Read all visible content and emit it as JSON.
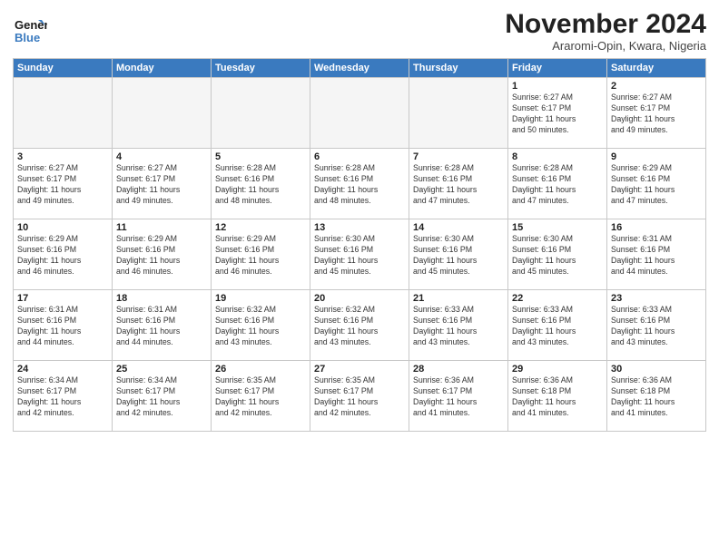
{
  "header": {
    "logo_line1": "General",
    "logo_line2": "Blue",
    "title": "November 2024",
    "subtitle": "Araromi-Opin, Kwara, Nigeria"
  },
  "days_of_week": [
    "Sunday",
    "Monday",
    "Tuesday",
    "Wednesday",
    "Thursday",
    "Friday",
    "Saturday"
  ],
  "weeks": [
    [
      {
        "day": "",
        "info": "",
        "empty": true
      },
      {
        "day": "",
        "info": "",
        "empty": true
      },
      {
        "day": "",
        "info": "",
        "empty": true
      },
      {
        "day": "",
        "info": "",
        "empty": true
      },
      {
        "day": "",
        "info": "",
        "empty": true
      },
      {
        "day": "1",
        "info": "Sunrise: 6:27 AM\nSunset: 6:17 PM\nDaylight: 11 hours\nand 50 minutes."
      },
      {
        "day": "2",
        "info": "Sunrise: 6:27 AM\nSunset: 6:17 PM\nDaylight: 11 hours\nand 49 minutes."
      }
    ],
    [
      {
        "day": "3",
        "info": "Sunrise: 6:27 AM\nSunset: 6:17 PM\nDaylight: 11 hours\nand 49 minutes."
      },
      {
        "day": "4",
        "info": "Sunrise: 6:27 AM\nSunset: 6:17 PM\nDaylight: 11 hours\nand 49 minutes."
      },
      {
        "day": "5",
        "info": "Sunrise: 6:28 AM\nSunset: 6:16 PM\nDaylight: 11 hours\nand 48 minutes."
      },
      {
        "day": "6",
        "info": "Sunrise: 6:28 AM\nSunset: 6:16 PM\nDaylight: 11 hours\nand 48 minutes."
      },
      {
        "day": "7",
        "info": "Sunrise: 6:28 AM\nSunset: 6:16 PM\nDaylight: 11 hours\nand 47 minutes."
      },
      {
        "day": "8",
        "info": "Sunrise: 6:28 AM\nSunset: 6:16 PM\nDaylight: 11 hours\nand 47 minutes."
      },
      {
        "day": "9",
        "info": "Sunrise: 6:29 AM\nSunset: 6:16 PM\nDaylight: 11 hours\nand 47 minutes."
      }
    ],
    [
      {
        "day": "10",
        "info": "Sunrise: 6:29 AM\nSunset: 6:16 PM\nDaylight: 11 hours\nand 46 minutes."
      },
      {
        "day": "11",
        "info": "Sunrise: 6:29 AM\nSunset: 6:16 PM\nDaylight: 11 hours\nand 46 minutes."
      },
      {
        "day": "12",
        "info": "Sunrise: 6:29 AM\nSunset: 6:16 PM\nDaylight: 11 hours\nand 46 minutes."
      },
      {
        "day": "13",
        "info": "Sunrise: 6:30 AM\nSunset: 6:16 PM\nDaylight: 11 hours\nand 45 minutes."
      },
      {
        "day": "14",
        "info": "Sunrise: 6:30 AM\nSunset: 6:16 PM\nDaylight: 11 hours\nand 45 minutes."
      },
      {
        "day": "15",
        "info": "Sunrise: 6:30 AM\nSunset: 6:16 PM\nDaylight: 11 hours\nand 45 minutes."
      },
      {
        "day": "16",
        "info": "Sunrise: 6:31 AM\nSunset: 6:16 PM\nDaylight: 11 hours\nand 44 minutes."
      }
    ],
    [
      {
        "day": "17",
        "info": "Sunrise: 6:31 AM\nSunset: 6:16 PM\nDaylight: 11 hours\nand 44 minutes."
      },
      {
        "day": "18",
        "info": "Sunrise: 6:31 AM\nSunset: 6:16 PM\nDaylight: 11 hours\nand 44 minutes."
      },
      {
        "day": "19",
        "info": "Sunrise: 6:32 AM\nSunset: 6:16 PM\nDaylight: 11 hours\nand 43 minutes."
      },
      {
        "day": "20",
        "info": "Sunrise: 6:32 AM\nSunset: 6:16 PM\nDaylight: 11 hours\nand 43 minutes."
      },
      {
        "day": "21",
        "info": "Sunrise: 6:33 AM\nSunset: 6:16 PM\nDaylight: 11 hours\nand 43 minutes."
      },
      {
        "day": "22",
        "info": "Sunrise: 6:33 AM\nSunset: 6:16 PM\nDaylight: 11 hours\nand 43 minutes."
      },
      {
        "day": "23",
        "info": "Sunrise: 6:33 AM\nSunset: 6:16 PM\nDaylight: 11 hours\nand 43 minutes."
      }
    ],
    [
      {
        "day": "24",
        "info": "Sunrise: 6:34 AM\nSunset: 6:17 PM\nDaylight: 11 hours\nand 42 minutes."
      },
      {
        "day": "25",
        "info": "Sunrise: 6:34 AM\nSunset: 6:17 PM\nDaylight: 11 hours\nand 42 minutes."
      },
      {
        "day": "26",
        "info": "Sunrise: 6:35 AM\nSunset: 6:17 PM\nDaylight: 11 hours\nand 42 minutes."
      },
      {
        "day": "27",
        "info": "Sunrise: 6:35 AM\nSunset: 6:17 PM\nDaylight: 11 hours\nand 42 minutes."
      },
      {
        "day": "28",
        "info": "Sunrise: 6:36 AM\nSunset: 6:17 PM\nDaylight: 11 hours\nand 41 minutes."
      },
      {
        "day": "29",
        "info": "Sunrise: 6:36 AM\nSunset: 6:18 PM\nDaylight: 11 hours\nand 41 minutes."
      },
      {
        "day": "30",
        "info": "Sunrise: 6:36 AM\nSunset: 6:18 PM\nDaylight: 11 hours\nand 41 minutes."
      }
    ]
  ]
}
